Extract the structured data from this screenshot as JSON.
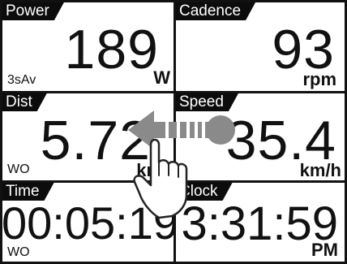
{
  "fields": [
    {
      "id": "power",
      "label": "Power",
      "value": "189",
      "unit": "W",
      "mode": "3sAv"
    },
    {
      "id": "cadence",
      "label": "Cadence",
      "value": "93",
      "unit": "rpm",
      "mode": ""
    },
    {
      "id": "dist",
      "label": "Dist",
      "value": "5.72",
      "unit": "km",
      "mode": "WO"
    },
    {
      "id": "speed",
      "label": "Speed",
      "value": "35.4",
      "unit": "km/h",
      "mode": ""
    },
    {
      "id": "time",
      "label": "Time",
      "value": "00:05:19",
      "unit": "",
      "mode": "WO"
    },
    {
      "id": "clock",
      "label": "Clock",
      "value": "3:31:59",
      "unit": "PM",
      "mode": ""
    }
  ],
  "gesture": {
    "type": "swipe-left",
    "icon": "swipe-left-hand-icon",
    "color": "#888888"
  }
}
